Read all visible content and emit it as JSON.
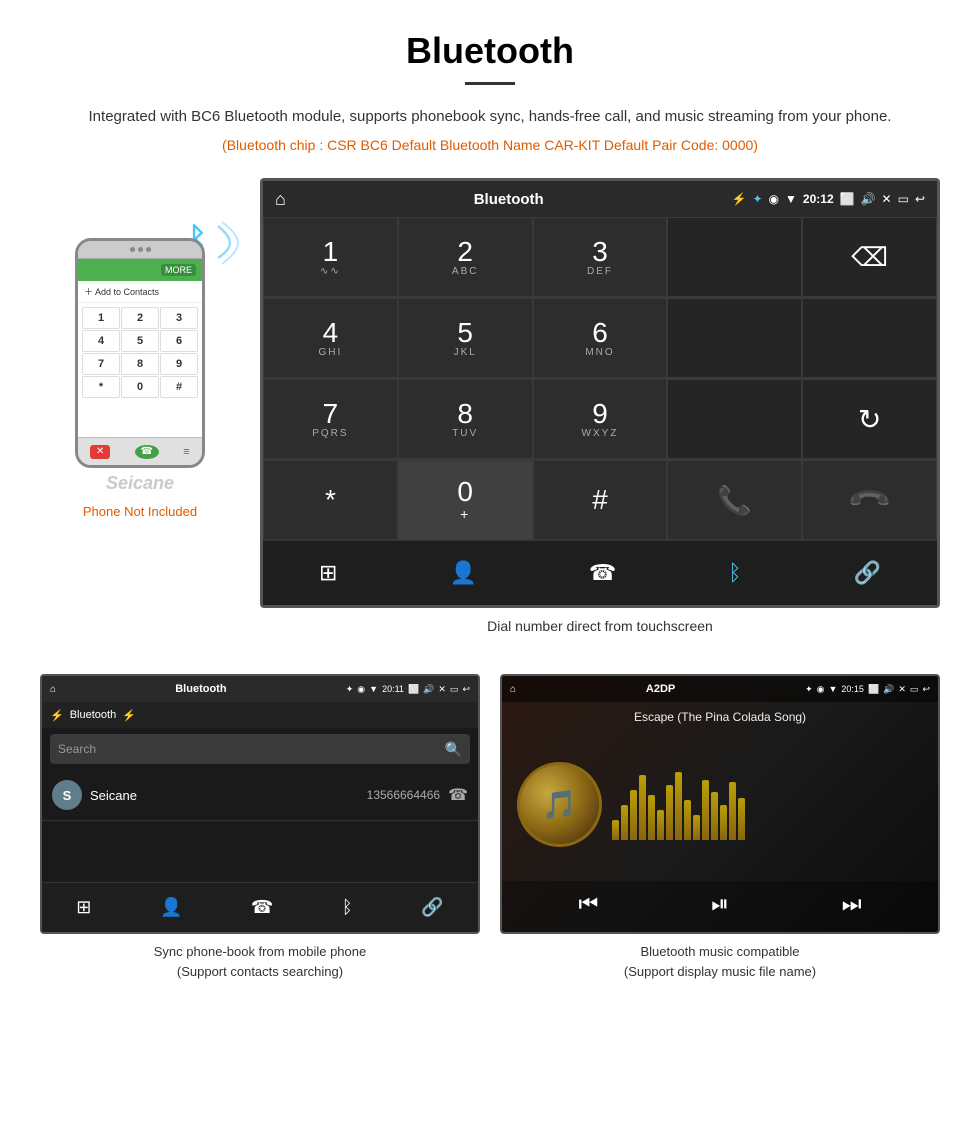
{
  "page": {
    "title": "Bluetooth",
    "description": "Integrated with BC6 Bluetooth module, supports phonebook sync, hands-free call, and music streaming from your phone.",
    "specs": "(Bluetooth chip : CSR BC6    Default Bluetooth Name CAR-KIT    Default Pair Code: 0000)"
  },
  "phone_note": "Phone Not Included",
  "main_screen": {
    "status_bar": {
      "title": "Bluetooth",
      "time": "20:12",
      "icons": [
        "home",
        "bluetooth",
        "usb",
        "location",
        "wifi",
        "signal",
        "camera",
        "volume",
        "close",
        "rect",
        "back"
      ]
    },
    "dialpad": {
      "keys": [
        {
          "num": "1",
          "sub": "∿∿"
        },
        {
          "num": "2",
          "sub": "ABC"
        },
        {
          "num": "3",
          "sub": "DEF"
        },
        {
          "num": "",
          "sub": ""
        },
        {
          "num": "⌫",
          "sub": ""
        },
        {
          "num": "4",
          "sub": "GHI"
        },
        {
          "num": "5",
          "sub": "JKL"
        },
        {
          "num": "6",
          "sub": "MNO"
        },
        {
          "num": "",
          "sub": ""
        },
        {
          "num": "",
          "sub": ""
        },
        {
          "num": "7",
          "sub": "PQRS"
        },
        {
          "num": "8",
          "sub": "TUV"
        },
        {
          "num": "9",
          "sub": "WXYZ"
        },
        {
          "num": "",
          "sub": ""
        },
        {
          "num": "↻",
          "sub": ""
        },
        {
          "num": "*",
          "sub": ""
        },
        {
          "num": "0",
          "sub": "+"
        },
        {
          "num": "#",
          "sub": ""
        },
        {
          "num": "📞green",
          "sub": ""
        },
        {
          "num": "📞red",
          "sub": ""
        }
      ]
    },
    "caption": "Dial number direct from touchscreen"
  },
  "phonebook_screen": {
    "status_bar_left": "❋ ♦ ▼ 20:11",
    "status_bar_right": "📷 🔊 ✕ ▭ ↩",
    "title": "Bluetooth",
    "search_placeholder": "Search",
    "contact": {
      "initial": "S",
      "name": "Seicane",
      "number": "13566664466"
    },
    "caption_line1": "Sync phone-book from mobile phone",
    "caption_line2": "(Support contacts searching)"
  },
  "music_screen": {
    "status_bar_left": "❋ ♦ ▼ 20:15",
    "status_bar_right": "📷 🔊 ✕ ▭ ↩",
    "title": "A2DP",
    "song_title": "Escape (The Pina Colada Song)",
    "viz_heights": [
      20,
      35,
      50,
      65,
      45,
      30,
      55,
      70,
      40,
      25,
      60,
      50,
      35,
      45,
      55,
      30,
      40,
      65,
      50,
      35
    ],
    "caption_line1": "Bluetooth music compatible",
    "caption_line2": "(Support display music file name)"
  },
  "dialpad_bottom_icons": [
    "grid",
    "person",
    "phone",
    "bluetooth",
    "link"
  ]
}
